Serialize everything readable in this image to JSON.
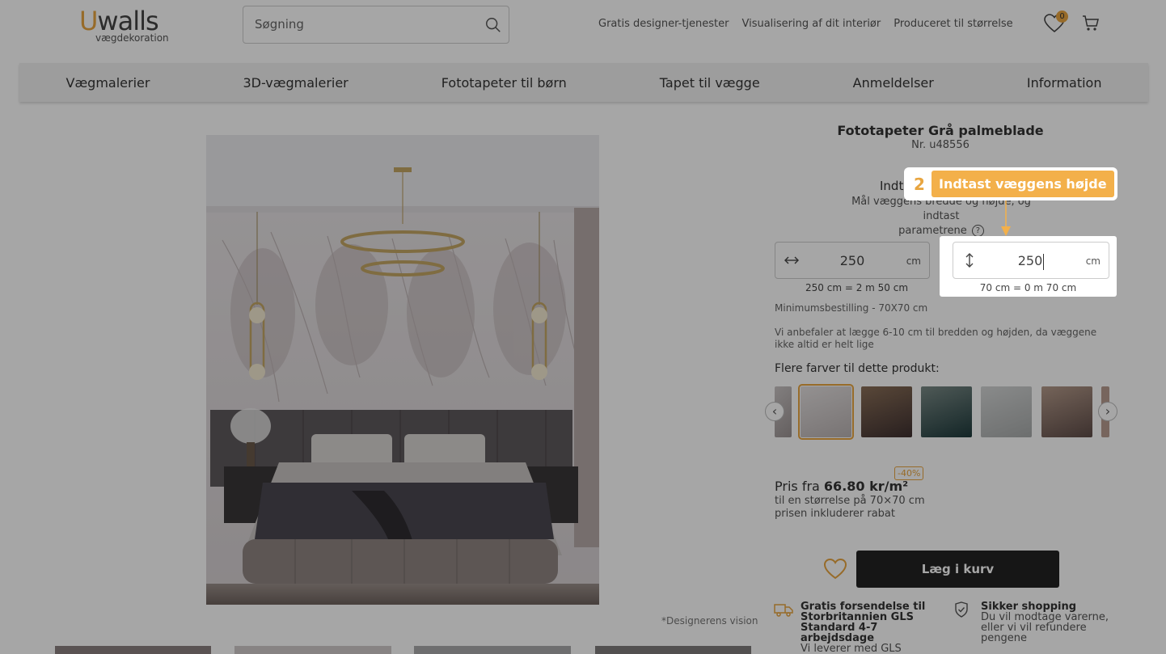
{
  "header": {
    "logo_main_first": "U",
    "logo_main_rest": "walls",
    "logo_sub": "vægdekoration",
    "search_placeholder": "Søgning",
    "links": [
      "Gratis designer-tjenester",
      "Visualisering af dit interiør",
      "Produceret til størrelse"
    ],
    "wishlist_count": "0"
  },
  "nav": [
    "Vægmalerier",
    "3D-vægmalerier",
    "Fototapeter til børn",
    "Tapet til vægge",
    "Anmeldelser",
    "Information"
  ],
  "product": {
    "title": "Fototapeter Grå palmeblade",
    "number": "Nr. u48556",
    "designer_note": "*Designerens vision"
  },
  "dimensions": {
    "title": "Indt",
    "desc_line1": "Mål væggens bredde og højde, og indtast",
    "desc_line2": "parametrene",
    "help": "?",
    "width_value": "250",
    "width_unit": "cm",
    "width_sub": "250 cm = 2 m 50 cm",
    "height_value": "250",
    "height_unit": "cm",
    "height_sub": "70 cm = 0 m 70 cm",
    "min_order": "Minimumsbestilling - 70X70 cm",
    "recommend": "Vi anbefaler at lægge 6-10 cm til bredden og højden, da væggene ikke altid er helt lige"
  },
  "colors": {
    "title": "Flere farver til dette produkt:",
    "prev": "‹",
    "next": "›"
  },
  "price": {
    "prefix": "Pris fra",
    "value": "66.80 kr/m²",
    "discount": "-40%",
    "sub1": "til en størrelse på 70×70 cm",
    "sub2": "prisen inkluderer rabat"
  },
  "cart": {
    "label": "Læg i kurv"
  },
  "usp": [
    {
      "title": "Gratis forsendelse til Storbritannien GLS Standard 4-7 arbejdsdage",
      "desc": "Vi leverer med GLS"
    },
    {
      "title": "Sikker shopping",
      "desc": "Du vil modtage varerne, eller vi vil refundere pengene"
    }
  ],
  "tutorial": {
    "step": "2",
    "label": "Indtast væggens højde"
  },
  "colors_theme": {
    "accent": "#e8a540",
    "dark": "#222222"
  }
}
